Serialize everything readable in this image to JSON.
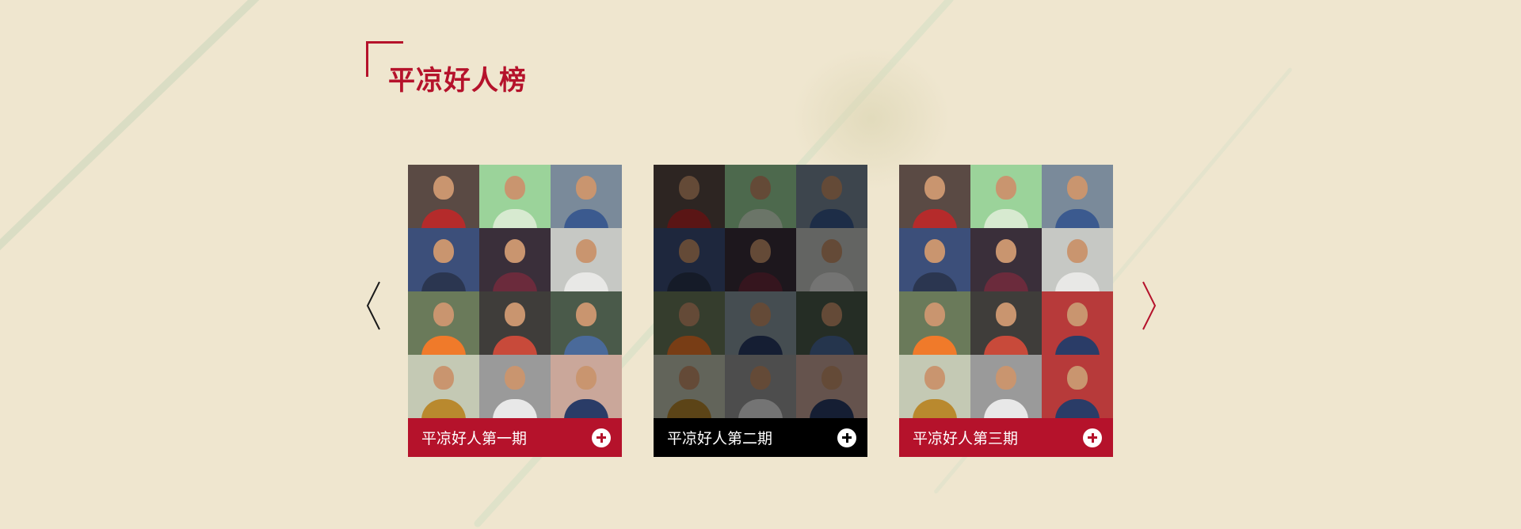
{
  "section": {
    "title": "平凉好人榜"
  },
  "nav": {
    "prev_icon": "chevron-left-icon",
    "next_icon": "chevron-right-icon",
    "prev_color": "#1a1a1a",
    "next_color": "#b5122b"
  },
  "colors": {
    "accent": "#b5122b",
    "background": "#efe6cf",
    "active_caption": "#000000"
  },
  "cards": [
    {
      "label": "平凉好人第一期",
      "caption_color": "#b5122b",
      "dimmed": false,
      "tiles": [
        [
          "#5a4a44",
          "#b52b2b"
        ],
        [
          "#9bd39a",
          "#d7ead0"
        ],
        [
          "#7a8a9a",
          "#3b5a8f"
        ],
        [
          "#3c4f7a",
          "#2b3650"
        ],
        [
          "#3a2f3a",
          "#6b2b3c"
        ],
        [
          "#c6c8c4",
          "#e8e8e6"
        ],
        [
          "#6a7a5a",
          "#f07a2a"
        ],
        [
          "#3f3d3a",
          "#c84a3a"
        ],
        [
          "#4a5a4a",
          "#4a6a9a"
        ],
        [
          "#c4c9b4",
          "#b9892e"
        ],
        [
          "#9a9a9a",
          "#e8e8e8"
        ],
        [
          "#caa79a",
          "#2a3c67"
        ]
      ]
    },
    {
      "label": "平凉好人第二期",
      "caption_color": "#000000",
      "dimmed": true,
      "tiles": [
        [
          "#5a4a44",
          "#b52b2b"
        ],
        [
          "#9bd39a",
          "#d7ead0"
        ],
        [
          "#7a8a9a",
          "#3b5a8f"
        ],
        [
          "#3c4f7a",
          "#2b3650"
        ],
        [
          "#3a2f3a",
          "#6b2b3c"
        ],
        [
          "#c6c8c4",
          "#e8e8e6"
        ],
        [
          "#6a7a5a",
          "#f07a2a"
        ],
        [
          "#8a9aa2",
          "#2a3c67"
        ],
        [
          "#4a5a4a",
          "#4a6a9a"
        ],
        [
          "#c4c9b4",
          "#b9892e"
        ],
        [
          "#9a9a9a",
          "#e8e8e8"
        ],
        [
          "#caa79a",
          "#2a3c67"
        ]
      ]
    },
    {
      "label": "平凉好人第三期",
      "caption_color": "#b5122b",
      "dimmed": false,
      "tiles": [
        [
          "#5a4a44",
          "#b52b2b"
        ],
        [
          "#9bd39a",
          "#d7ead0"
        ],
        [
          "#7a8a9a",
          "#3b5a8f"
        ],
        [
          "#3c4f7a",
          "#2b3650"
        ],
        [
          "#3a2f3a",
          "#6b2b3c"
        ],
        [
          "#c6c8c4",
          "#e8e8e6"
        ],
        [
          "#6a7a5a",
          "#f07a2a"
        ],
        [
          "#3f3d3a",
          "#c84a3a"
        ],
        [
          "#b73a3a",
          "#2a3c67"
        ],
        [
          "#c4c9b4",
          "#b9892e"
        ],
        [
          "#9a9a9a",
          "#e8e8e8"
        ],
        [
          "#b73a3a",
          "#2a3c67"
        ]
      ]
    }
  ]
}
